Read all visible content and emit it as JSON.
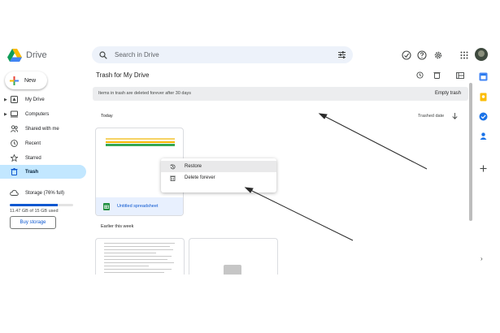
{
  "header": {
    "app_name": "Drive",
    "search_placeholder": "Search in Drive",
    "icons": [
      "drive-logo-icon",
      "search-icon",
      "tune-icon",
      "offline-icon",
      "help-icon",
      "settings-icon",
      "apps-grid-icon",
      "avatar"
    ]
  },
  "sidebar": {
    "new_label": "New",
    "items": [
      {
        "label": "My Drive",
        "icon": "my-drive-icon",
        "expandable": true
      },
      {
        "label": "Computers",
        "icon": "computers-icon",
        "expandable": true
      },
      {
        "label": "Shared with me",
        "icon": "shared-icon",
        "expandable": false
      },
      {
        "label": "Recent",
        "icon": "recent-icon",
        "expandable": false
      },
      {
        "label": "Starred",
        "icon": "star-icon",
        "expandable": false
      },
      {
        "label": "Trash",
        "icon": "trash-icon",
        "expandable": false,
        "active": true
      }
    ],
    "storage_label": "Storage (76% full)",
    "storage_used_fraction": 0.76,
    "storage_text": "11.47 GB of 15 GB used",
    "buy_storage": "Buy storage"
  },
  "main": {
    "title": "Trash for My Drive",
    "banner_text": "Items in trash are deleted forever after 30 days",
    "empty_trash": "Empty trash",
    "section_today": "Today",
    "sort_label": "Trashed date",
    "section_earlier": "Earlier this week",
    "file_name": "Untitled spreadsheet"
  },
  "context_menu": {
    "items": [
      {
        "label": "Restore",
        "icon": "restore-icon"
      },
      {
        "label": "Delete forever",
        "icon": "delete-icon"
      }
    ]
  },
  "colors": {
    "accent": "#0b57d0",
    "active_nav": "#c2e7ff",
    "sheets_green": "#1e8e3e"
  }
}
